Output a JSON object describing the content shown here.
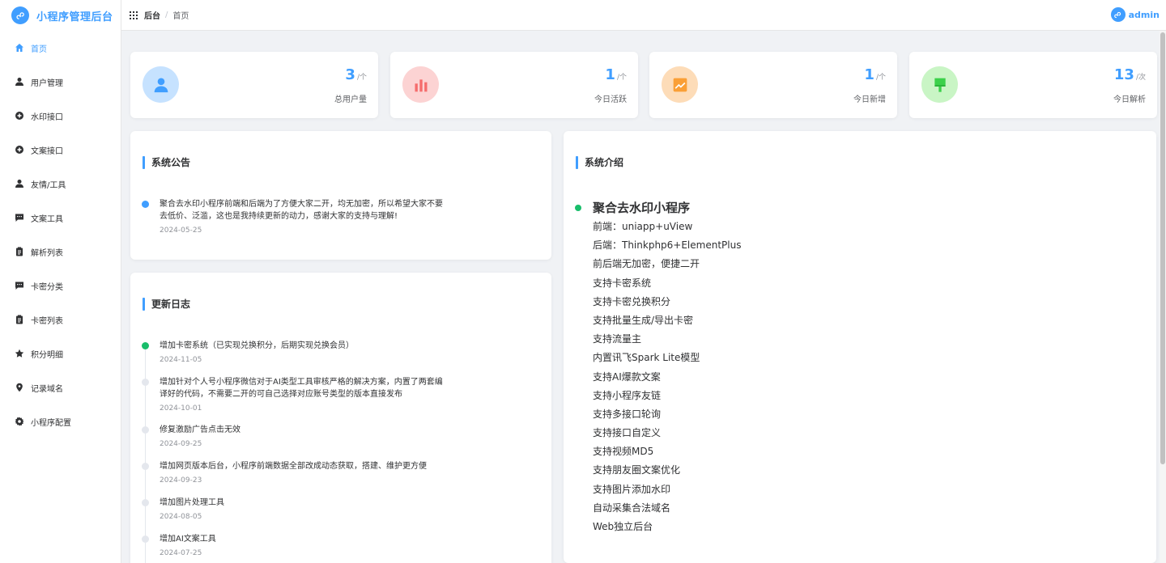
{
  "app": {
    "title": "小程序管理后台",
    "accent": "#409eff"
  },
  "sidebar": {
    "items": [
      {
        "label": "首页",
        "icon": "home-icon",
        "active": true
      },
      {
        "label": "用户管理",
        "icon": "user-icon"
      },
      {
        "label": "水印接口",
        "icon": "circle-plus-icon"
      },
      {
        "label": "文案接口",
        "icon": "circle-plus-icon"
      },
      {
        "label": "友情/工具",
        "icon": "user-icon"
      },
      {
        "label": "文案工具",
        "icon": "chat-icon"
      },
      {
        "label": "解析列表",
        "icon": "clipboard-icon"
      },
      {
        "label": "卡密分类",
        "icon": "chat-icon"
      },
      {
        "label": "卡密列表",
        "icon": "clipboard-icon"
      },
      {
        "label": "积分明细",
        "icon": "star-icon"
      },
      {
        "label": "记录域名",
        "icon": "location-icon"
      },
      {
        "label": "小程序配置",
        "icon": "gear-icon"
      }
    ]
  },
  "header": {
    "breadcrumb": [
      "后台",
      "首页"
    ],
    "user": "admin"
  },
  "stats": [
    {
      "value": "3",
      "unit": "/个",
      "label": "总用户量",
      "icon": "user-icon",
      "bg": "#c6e2ff",
      "color": "#409eff"
    },
    {
      "value": "1",
      "unit": "/个",
      "label": "今日活跃",
      "icon": "bar-chart-icon",
      "bg": "#fcd3d3",
      "color": "#f56c6c"
    },
    {
      "value": "1",
      "unit": "/个",
      "label": "今日新增",
      "icon": "trend-icon",
      "bg": "#fddcb8",
      "color": "#fa9f36"
    },
    {
      "value": "13",
      "unit": "/次",
      "label": "今日解析",
      "icon": "brush-icon",
      "bg": "#c9f5c5",
      "color": "#3bd14a"
    }
  ],
  "announcement": {
    "title": "系统公告",
    "items": [
      {
        "text": "聚合去水印小程序前端和后端为了方便大家二开，均无加密，所以希望大家不要去低价、泛滥，这也是我持续更新的动力，感谢大家的支持与理解!",
        "time": "2024-05-25"
      }
    ]
  },
  "changelog": {
    "title": "更新日志",
    "items": [
      {
        "text": "增加卡密系统（已实现兑换积分，后期实现兑换会员）",
        "time": "2024-11-05",
        "active": true
      },
      {
        "text": "增加针对个人号小程序微信对于AI类型工具审核严格的解决方案，内置了两套编译好的代码，不需要二开的可自己选择对应账号类型的版本直接发布",
        "time": "2024-10-01"
      },
      {
        "text": "修复激励广告点击无效",
        "time": "2024-09-25"
      },
      {
        "text": "增加网页版本后台，小程序前端数据全部改成动态获取，搭建、维护更方便",
        "time": "2024-09-23"
      },
      {
        "text": "增加图片处理工具",
        "time": "2024-08-05"
      },
      {
        "text": "增加AI文案工具",
        "time": "2024-07-25"
      }
    ]
  },
  "intro": {
    "title": "系统介绍",
    "heading": "聚合去水印小程序",
    "features": [
      "前端：uniapp+uView",
      "后端：Thinkphp6+ElementPlus",
      "前后端无加密，便捷二开",
      "支持卡密系统",
      "支持卡密兑换积分",
      "支持批量生成/导出卡密",
      "支持流量主",
      "内置讯飞Spark Lite模型",
      "支持AI爆款文案",
      "支持小程序友链",
      "支持多接口轮询",
      "支持接口自定义",
      "支持视频MD5",
      "支持朋友圈文案优化",
      "支持图片添加水印",
      "自动采集合法域名",
      "Web独立后台"
    ]
  }
}
